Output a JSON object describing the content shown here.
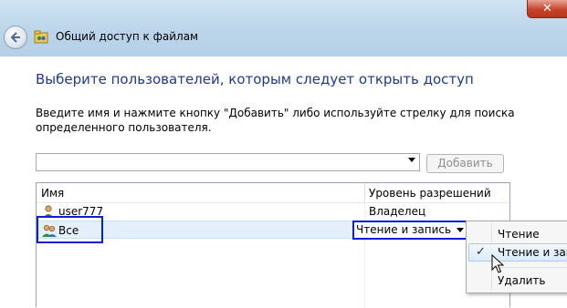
{
  "window": {
    "title": "Общий доступ к файлам",
    "close_symbol": "✕"
  },
  "heading": "Выберите пользователей, которым следует открыть доступ",
  "instruction": "Введите имя и нажмите кнопку \"Добавить\" либо используйте стрелку для поиска определенного пользователя.",
  "input": {
    "value": "",
    "placeholder": ""
  },
  "add_button_label": "Добавить",
  "table": {
    "headers": [
      "Имя",
      "Уровень разрешений"
    ],
    "rows": [
      {
        "name": "user777",
        "level": "Владелец"
      },
      {
        "name": "Все",
        "level": "Чтение и запись"
      }
    ]
  },
  "permission_menu": {
    "items": [
      "Чтение",
      "Чтение и запись",
      "Удалить"
    ],
    "checked_index": 1,
    "check_symbol": "✓"
  },
  "colors": {
    "heading": "#1e3a8c",
    "highlight_box": "#0a1fd6",
    "selected_row": "#e3f0fb"
  },
  "icons": [
    "back-arrow-icon",
    "file-sharing-icon",
    "user-icon",
    "users-group-icon",
    "dropdown-arrow-icon",
    "checkmark-icon",
    "mouse-cursor-icon",
    "close-icon"
  ]
}
